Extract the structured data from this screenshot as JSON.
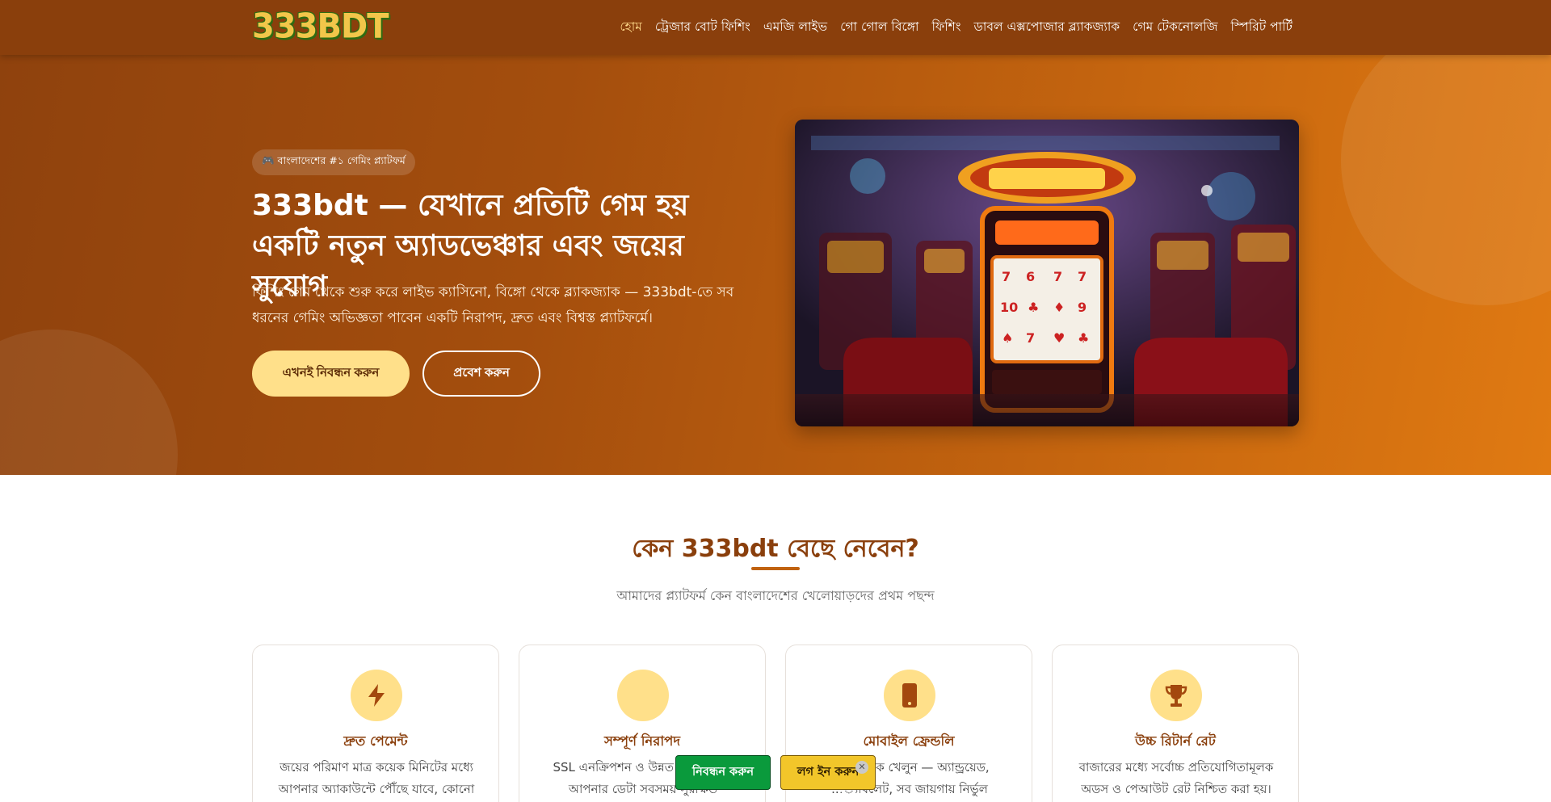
{
  "header": {
    "logo_text": "333BDT",
    "nav": [
      {
        "label": "হোম"
      },
      {
        "label": "ট্রেজার বোট ফিশিং"
      },
      {
        "label": "এমজি লাইভ"
      },
      {
        "label": "গো গোল বিঙ্গো"
      },
      {
        "label": "ফিশিং"
      },
      {
        "label": "ডাবল এক্সপোজার ব্ল্যাকজ্যাক"
      },
      {
        "label": "গেম টেকনোলজি"
      },
      {
        "label": "স্পিরিট পার্টি"
      }
    ]
  },
  "hero": {
    "badge": "🎮 বাংলাদেশের #১ গেমিং প্ল্যাটফর্ম",
    "title": "333bdt — যেখানে প্রতিটি গেম হয় একটি নতুন অ্যাডভেঞ্চার এবং জয়ের সুযোগ",
    "description": "ফিশিং গেম থেকে শুরু করে লাইভ ক্যাসিনো, বিঙ্গো থেকে ব্ল্যাকজ্যাক — 333bdt-তে সব ধরনের গেমিং অভিজ্ঞতা পাবেন একটি নিরাপদ, দ্রুত এবং বিশ্বস্ত প্ল্যাটফর্মে।",
    "primary_button": "এখনই নিবন্ধন করুন",
    "secondary_button": "প্রবেশ করুন"
  },
  "features": {
    "title": "কেন 333bdt বেছে নেবেন?",
    "subtitle": "আমাদের প্ল্যাটফর্ম কেন বাংলাদেশের খেলোয়াড়দের প্রথম পছন্দ",
    "cards": [
      {
        "icon": "lightning-icon",
        "title": "দ্রুত পেমেন্ট",
        "text": "জয়ের পরিমাণ মাত্র কয়েক মিনিটের মধ্যে আপনার অ্যাকাউন্টে পৌঁছে যাবে, কোনো"
      },
      {
        "icon": "shield-icon",
        "title": "সম্পূর্ণ নিরাপদ",
        "text": "SSL এনক্রিপশন ও উন্নত সু... মাধ্যমে আপনার ডেটা সবসময় সুরক্ষিত"
      },
      {
        "icon": "mobile-icon",
        "title": "মোবাইল ফ্রেন্ডলি",
        "text": "...সে থেকে খেলুন — অ্যান্ড্রয়েড, ...্যাবলেট, সব জায়গায় নির্ভুল"
      },
      {
        "icon": "trophy-icon",
        "title": "উচ্চ রিটার্ন রেট",
        "text": "বাজারের মধ্যে সর্বোচ্চ প্রতিযোগিতামূলক অডস ও পেআউট রেট নিশ্চিত করা হয়।"
      }
    ]
  },
  "floating": {
    "register": "নিবন্ধন করুন",
    "login": "লগ ইন করুন",
    "close": "✕"
  },
  "colors": {
    "header_bg": "#8a3f0c",
    "accent": "#ffe08a",
    "title": "#8a3f0c",
    "register_green": "#0a9a3c",
    "login_yellow": "#f2c62a"
  }
}
